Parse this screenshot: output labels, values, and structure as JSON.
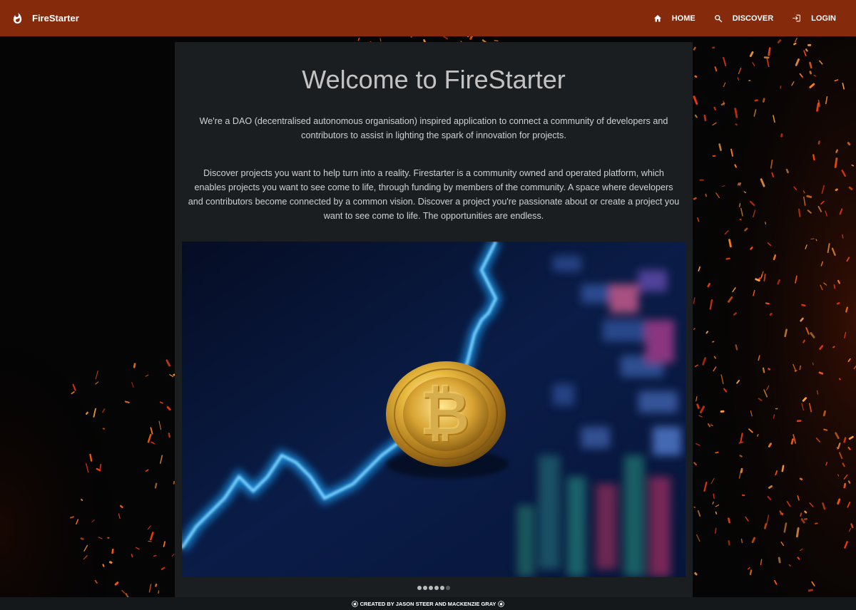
{
  "navbar": {
    "brand": "FireStarter",
    "links": [
      {
        "label": "HOME",
        "icon": "home-icon"
      },
      {
        "label": "DISCOVER",
        "icon": "search-icon"
      },
      {
        "label": "LOGIN",
        "icon": "login-icon"
      }
    ]
  },
  "main": {
    "title": "Welcome to FireStarter",
    "paragraph1": "We're a DAO (decentralised autonomous organisation) inspired application to connect a community of developers and contributors to assist in lighting the spark of innovation for projects.",
    "paragraph2": "Discover projects you want to help turn into a reality. Firestarter is a community owned and operated platform, which enables projects you want to see come to life, through funding by members of the community. A space where developers and contributors become connected by a common vision. Discover a project you're passionate about or create a project you want to see come to life. The opportunities are endless."
  },
  "carousel": {
    "slide_count": 6,
    "active_index": 5
  },
  "footer": {
    "text": "CREATED BY JASON STEER AND MACKENZIE GRAY"
  },
  "colors": {
    "navbar": "#862a0c",
    "card": "#1b1e21",
    "footer": "#15181b",
    "spark": "#ff5a0a"
  }
}
